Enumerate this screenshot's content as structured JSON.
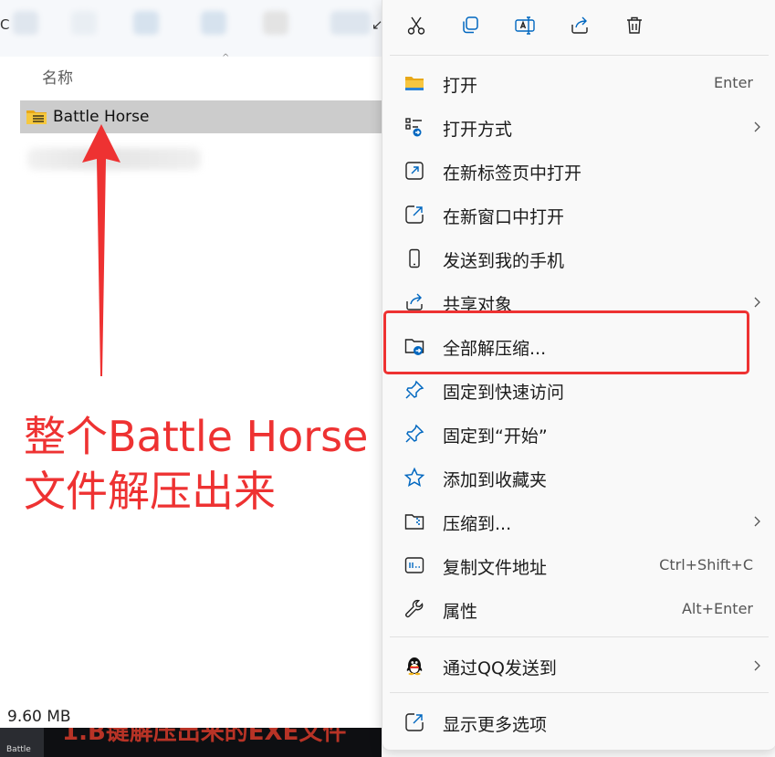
{
  "explorer": {
    "column_header": "名称",
    "file_name": "Battle Horse",
    "status_size": "9.60 MB",
    "taskbar_app_label": "Battle",
    "taskbar_caption": "1.B键解压出来的EXE文件",
    "toolbar_clip_left": "C",
    "toolbar_clip_right": "↙"
  },
  "annotation": {
    "line1": "整个Battle Horse",
    "line2": "文件解压出来",
    "color": "#ee3232"
  },
  "context_menu": {
    "quick_actions": [
      {
        "name": "cut",
        "icon": "scissors-icon"
      },
      {
        "name": "copy",
        "icon": "copy-icon"
      },
      {
        "name": "rename",
        "icon": "rename-icon"
      },
      {
        "name": "share",
        "icon": "share-icon"
      },
      {
        "name": "delete",
        "icon": "trash-icon"
      }
    ],
    "items": [
      {
        "label": "打开",
        "shortcut": "Enter",
        "icon": "folder-icon"
      },
      {
        "label": "打开方式",
        "submenu": true,
        "icon": "open-with-icon"
      },
      {
        "label": "在新标签页中打开",
        "icon": "new-tab-icon"
      },
      {
        "label": "在新窗口中打开",
        "icon": "new-window-icon"
      },
      {
        "label": "发送到我的手机",
        "icon": "phone-icon"
      },
      {
        "label": "共享对象",
        "submenu": true,
        "icon": "share-icon"
      },
      {
        "label": "全部解压缩...",
        "icon": "extract-all-icon",
        "highlighted": true
      },
      {
        "label": "固定到快速访问",
        "icon": "pin-icon"
      },
      {
        "label": "固定到“开始”",
        "icon": "pin-start-icon"
      },
      {
        "label": "添加到收藏夹",
        "icon": "star-icon"
      },
      {
        "label": "压缩到...",
        "submenu": true,
        "icon": "zip-icon"
      },
      {
        "label": "复制文件地址",
        "shortcut": "Ctrl+Shift+C",
        "icon": "copy-path-icon"
      },
      {
        "label": "属性",
        "shortcut": "Alt+Enter",
        "icon": "wrench-icon"
      },
      {
        "label": "通过QQ发送到",
        "submenu": true,
        "icon": "qq-penguin-icon"
      },
      {
        "label": "显示更多选项",
        "icon": "more-options-icon"
      }
    ],
    "accent": "#0067c0"
  }
}
